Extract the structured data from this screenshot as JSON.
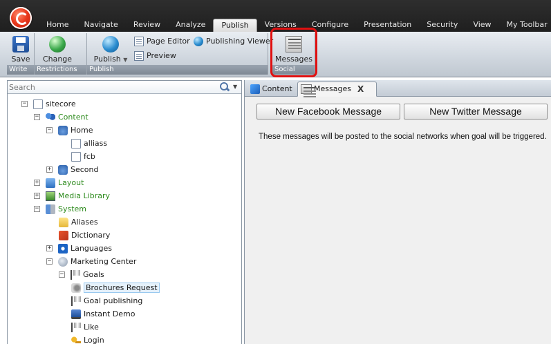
{
  "topbar": {
    "tabs": [
      "Home",
      "Navigate",
      "Review",
      "Analyze",
      "Publish",
      "Versions",
      "Configure",
      "Presentation",
      "Security",
      "View",
      "My Toolbar"
    ],
    "active_tab": "Publish"
  },
  "ribbon": {
    "groups": {
      "write": {
        "label": "Write",
        "save_label": "Save"
      },
      "restrictions": {
        "label": "Restrictions",
        "change_label": "Change"
      },
      "publish": {
        "label": "Publish",
        "publish_label": "Publish",
        "page_editor_label": "Page Editor",
        "preview_label": "Preview",
        "publishing_viewer_label": "Publishing Viewer"
      },
      "social": {
        "label": "Social",
        "messages_label": "Messages"
      }
    },
    "highlight_color": "#e01010"
  },
  "search": {
    "placeholder": "Search"
  },
  "tree": [
    {
      "label": "sitecore",
      "icon": "document-icon",
      "expander": "−",
      "green": false
    },
    {
      "label": "Content",
      "icon": "people-icon",
      "expander": "−",
      "green": true
    },
    {
      "label": "Home",
      "icon": "home-icon",
      "expander": "−",
      "green": false
    },
    {
      "label": "alliass",
      "icon": "document-icon",
      "expander": "",
      "green": false
    },
    {
      "label": "fcb",
      "icon": "document-icon",
      "expander": "",
      "green": false
    },
    {
      "label": "Second",
      "icon": "home-icon",
      "expander": "+",
      "green": false
    },
    {
      "label": "Layout",
      "icon": "layout-icon",
      "expander": "+",
      "green": true
    },
    {
      "label": "Media Library",
      "icon": "media-icon",
      "expander": "+",
      "green": true
    },
    {
      "label": "System",
      "icon": "system-icon",
      "expander": "−",
      "green": true
    },
    {
      "label": "Aliases",
      "icon": "folder-icon",
      "expander": "",
      "green": false
    },
    {
      "label": "Dictionary",
      "icon": "dictionary-icon",
      "expander": "",
      "green": false
    },
    {
      "label": "Languages",
      "icon": "languages-icon",
      "expander": "+",
      "green": false
    },
    {
      "label": "Marketing Center",
      "icon": "marketing-center-icon",
      "expander": "−",
      "green": false
    },
    {
      "label": "Goals",
      "icon": "flag-icon",
      "expander": "−",
      "green": false
    },
    {
      "label": "Brochures Request",
      "icon": "goal-icon",
      "expander": "",
      "green": false,
      "selected": true
    },
    {
      "label": "Goal publishing",
      "icon": "flag-icon",
      "expander": "",
      "green": false
    },
    {
      "label": "Instant Demo",
      "icon": "monitor-icon",
      "expander": "",
      "green": false
    },
    {
      "label": "Like",
      "icon": "flag-icon",
      "expander": "",
      "green": false
    },
    {
      "label": "Login",
      "icon": "key-icon",
      "expander": "",
      "green": false
    }
  ],
  "editor": {
    "tabs": {
      "content": "Content",
      "messages": "Messages",
      "close": "X"
    },
    "facebook_button": "New Facebook Message",
    "twitter_button": "New Twitter Message",
    "message": "These messages will be posted to the social networks when goal will be triggered."
  }
}
